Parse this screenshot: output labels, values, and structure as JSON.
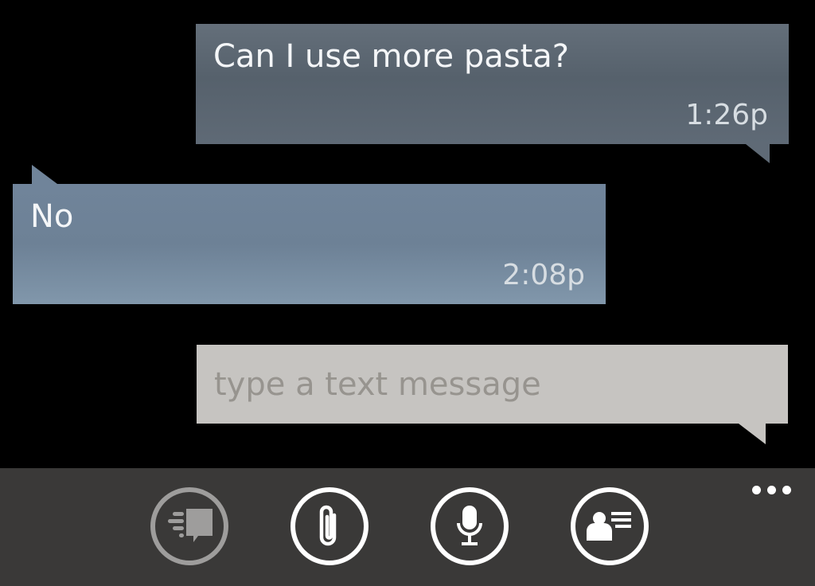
{
  "conversation": {
    "messages": [
      {
        "direction": "outgoing",
        "text": "Can I use more pasta?",
        "time": "1:26p"
      },
      {
        "direction": "incoming",
        "text": "No",
        "time": "2:08p"
      }
    ]
  },
  "compose": {
    "placeholder": "type a text message",
    "value": ""
  },
  "app_bar": {
    "buttons": [
      {
        "icon": "send-icon",
        "enabled": false
      },
      {
        "icon": "paperclip-icon",
        "enabled": true
      },
      {
        "icon": "microphone-icon",
        "enabled": true
      },
      {
        "icon": "contact-card-icon",
        "enabled": true
      }
    ],
    "more_icon": "more-ellipsis-icon"
  },
  "colors": {
    "background": "#000000",
    "outgoing_bubble": "#5f6a76",
    "incoming_bubble": "#70849a",
    "compose_box": "#c6c4c1",
    "app_bar": "#3a3938"
  }
}
